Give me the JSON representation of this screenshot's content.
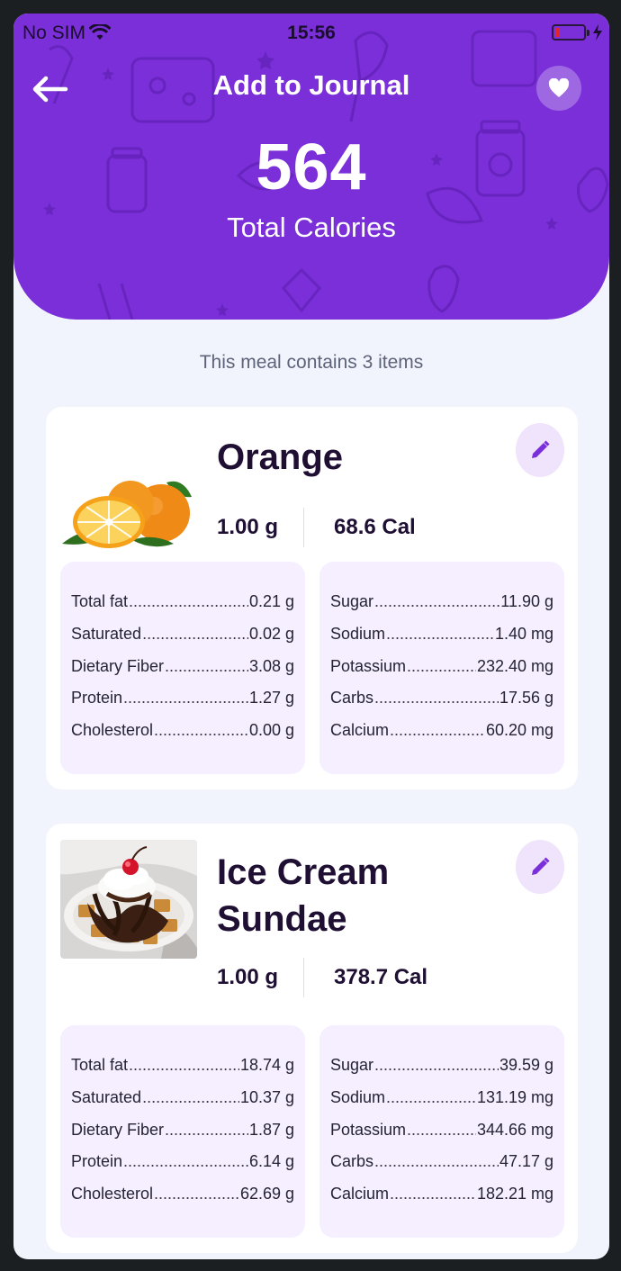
{
  "status_bar": {
    "carrier": "No SIM",
    "time": "15:56"
  },
  "header": {
    "title": "Add to Journal",
    "total_calories": "564",
    "total_calories_label": "Total Calories"
  },
  "meal_summary": "This meal contains 3 items",
  "colors": {
    "accent": "#7b2fd9",
    "card_panel": "#f5efff",
    "background": "#f2f4fd"
  },
  "foods": [
    {
      "name": "Orange",
      "quantity": "1.00 g",
      "calories": "68.6 Cal",
      "image_icon": "orange-image",
      "left_nutrients": [
        {
          "label": "Total fat",
          "value": "0.21 g"
        },
        {
          "label": "Saturated",
          "value": "0.02 g"
        },
        {
          "label": "Dietary Fiber",
          "value": "3.08 g"
        },
        {
          "label": "Protein",
          "value": "1.27 g"
        },
        {
          "label": "Cholesterol",
          "value": "0.00 g"
        }
      ],
      "right_nutrients": [
        {
          "label": "Sugar",
          "value": "11.90 g"
        },
        {
          "label": "Sodium",
          "value": "1.40 mg"
        },
        {
          "label": "Potassium",
          "value": "232.40 mg"
        },
        {
          "label": "Carbs",
          "value": "17.56 g"
        },
        {
          "label": "Calcium",
          "value": "60.20 mg"
        }
      ]
    },
    {
      "name": "Ice Cream Sundae",
      "quantity": "1.00 g",
      "calories": "378.7 Cal",
      "image_icon": "sundae-image",
      "left_nutrients": [
        {
          "label": "Total fat",
          "value": "18.74 g"
        },
        {
          "label": "Saturated",
          "value": "10.37 g"
        },
        {
          "label": "Dietary Fiber",
          "value": "1.87 g"
        },
        {
          "label": "Protein",
          "value": "6.14 g"
        },
        {
          "label": "Cholesterol",
          "value": "62.69 g"
        }
      ],
      "right_nutrients": [
        {
          "label": "Sugar",
          "value": "39.59 g"
        },
        {
          "label": "Sodium",
          "value": "131.19 mg"
        },
        {
          "label": "Potassium",
          "value": "344.66 mg"
        },
        {
          "label": "Carbs",
          "value": "47.17 g"
        },
        {
          "label": "Calcium",
          "value": "182.21 mg"
        }
      ]
    }
  ]
}
